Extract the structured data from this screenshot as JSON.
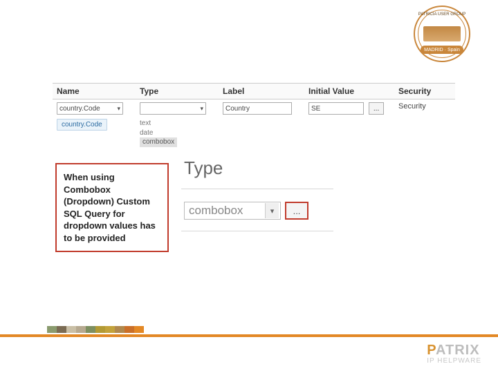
{
  "badge": {
    "top_text": "PATRICIA USER GROUP",
    "ribbon": "MADRID · Spain"
  },
  "table": {
    "headers": {
      "name": "Name",
      "type": "Type",
      "label": "Label",
      "initial": "Initial Value",
      "security": "Security"
    },
    "row": {
      "name_select": "country.Code",
      "name_tag": "country.Code",
      "type_select": "",
      "type_options": {
        "o1": "text",
        "o2": "date",
        "o3": "combobox"
      },
      "label_input": "Country",
      "initial_input": "SE",
      "dots": "...",
      "security_text": "Security"
    }
  },
  "callout": "When using Combobox (Dropdown) Custom SQL Query for dropdown values has to be provided",
  "zoom": {
    "header": "Type",
    "value": "combobox",
    "dots": "..."
  },
  "strip_colors": [
    "#8a9b6e",
    "#7a6b53",
    "#c9bfa6",
    "#b6a990",
    "#7d8f60",
    "#b29a34",
    "#c2a23b",
    "#b0884d",
    "#ca6f28",
    "#e38825"
  ],
  "brand": {
    "line1_pre": "P",
    "line1_rest": "ATRIX",
    "line2": "IP HELPWARE"
  }
}
